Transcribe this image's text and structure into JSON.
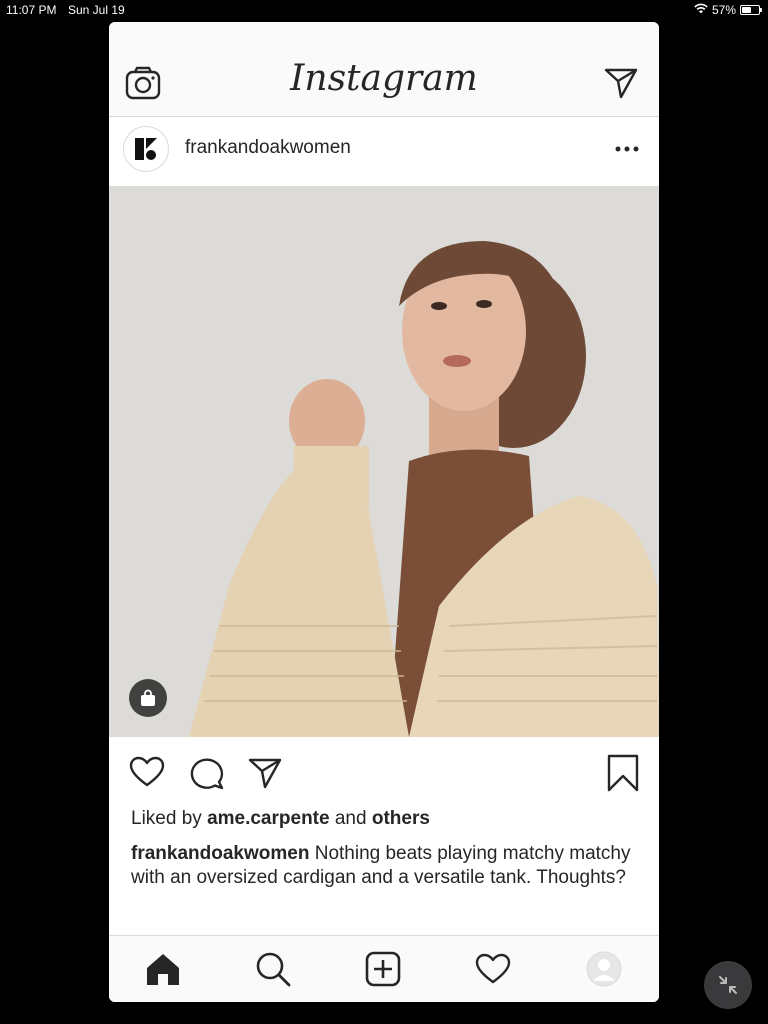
{
  "status_bar": {
    "time": "11:07 PM",
    "date": "Sun Jul 19",
    "battery": "57%",
    "battery_level": 0.57
  },
  "app": {
    "title": "Instagram"
  },
  "post": {
    "username": "frankandoakwomen",
    "liked_by_prefix": "Liked by",
    "liked_by_user": "ame.carpente",
    "liked_by_and": "and",
    "liked_by_others": "others",
    "caption_user": "frankandoakwomen",
    "caption_text": "Nothing beats playing matchy matchy with an oversized cardigan and a versatile tank. Thoughts?"
  },
  "icons": {
    "top_left": "camera-icon",
    "top_right": "direct-message-icon",
    "more": "more-options-icon",
    "shop": "shopping-bag-icon",
    "like": "heart-icon",
    "comment": "comment-icon",
    "share": "share-icon",
    "save": "bookmark-icon",
    "home": "home-icon",
    "search": "search-icon",
    "add": "add-post-icon",
    "activity": "activity-heart-icon",
    "profile": "profile-avatar-icon",
    "exit_fullscreen": "collapse-icon"
  },
  "colors": {
    "text": "#262626",
    "border": "#dbdbdb",
    "bar_bg": "#fafafa",
    "background": "#000000"
  }
}
